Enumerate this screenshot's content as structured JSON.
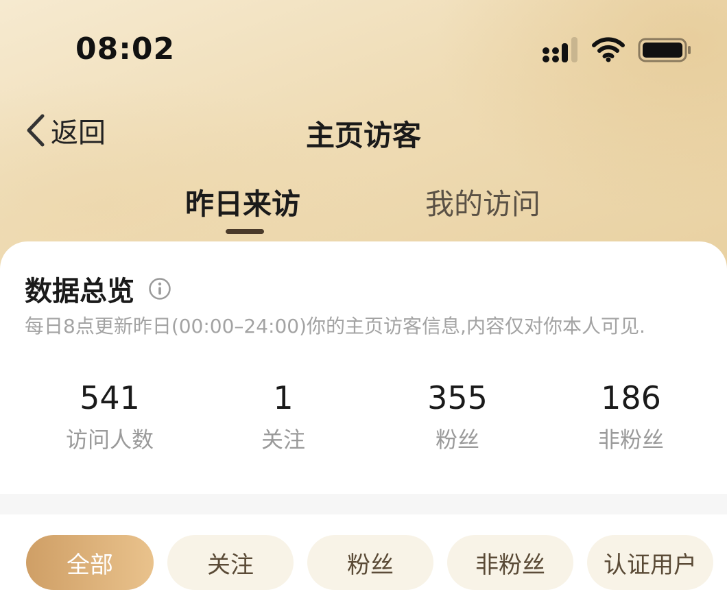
{
  "status_bar": {
    "time": "08:02"
  },
  "nav": {
    "back_label": "返回",
    "title": "主页访客"
  },
  "tabs": [
    {
      "label": "昨日来访",
      "active": true
    },
    {
      "label": "我的访问",
      "active": false
    }
  ],
  "overview": {
    "title": "数据总览",
    "description": "每日8点更新昨日(00:00–24:00)你的主页访客信息,内容仅对你本人可见.",
    "stats": [
      {
        "value": "541",
        "label": "访问人数"
      },
      {
        "value": "1",
        "label": "关注"
      },
      {
        "value": "355",
        "label": "粉丝"
      },
      {
        "value": "186",
        "label": "非粉丝"
      }
    ]
  },
  "filters": [
    {
      "label": "全部",
      "active": true
    },
    {
      "label": "关注",
      "active": false
    },
    {
      "label": "粉丝",
      "active": false
    },
    {
      "label": "非粉丝",
      "active": false
    },
    {
      "label": "认证用户",
      "active": false
    }
  ],
  "colors": {
    "accent_gradient_start": "#cf9f66",
    "accent_gradient_end": "#e9c28c",
    "chip_background": "#f8f3e7",
    "header_background": "#efdcb5"
  },
  "icons": {
    "back": "chevron-left-icon",
    "info": "info-circle-icon",
    "signal": "cellular-signal-icon",
    "wifi": "wifi-icon",
    "battery": "battery-icon"
  }
}
